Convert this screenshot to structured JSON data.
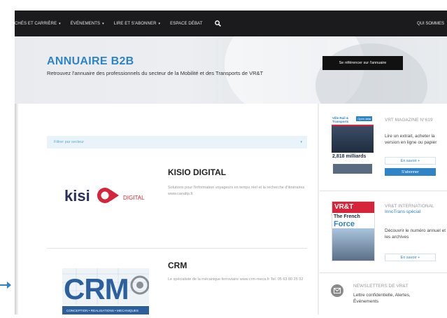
{
  "nav": {
    "items": [
      "CHÉS ET CARRIÈRE",
      "ÉVÉNEMENTS",
      "LIRE ET S'ABONNER",
      "ESPACE DÉBAT"
    ],
    "right": "QUI SOMMES"
  },
  "hero": {
    "title": "ANNUAIRE B2B",
    "subtitle": "Retrouvez l'annuaire des professionnels du secteur de la Mobilité et des Transports de VR&T",
    "button": "Se référencer sur l'annuaire"
  },
  "filter": {
    "placeholder": "Filtrer par secteur"
  },
  "companies": [
    {
      "name": "KISIO DIGITAL",
      "description": "Solutions pour l'information voyageurs en temps réel et la recherche d'itinéraires www.canaltp.fr",
      "logo_text": "kisio",
      "logo_sub": "DIGITAL"
    },
    {
      "name": "CRM",
      "description": "Le spécialiste de la mécanique ferroviaire www.crm-meca.fr Tel. 05 63 80 25 32",
      "logo_text": "CRM",
      "logo_sub": "CONCEPTION • REALISATIONS • MECANIQUES"
    }
  ],
  "sidebar": {
    "magazine": {
      "title": "VRT MAGAZINE N°619",
      "text": "Lire un extrait, acheter la version en ligne ou papier",
      "btn_more": "En savoir +",
      "btn_sub": "S'abonner",
      "cover_brand": "Ville Rail & Transports",
      "cover_tag": "Open data",
      "cover_headline": "2,818 milliards"
    },
    "international": {
      "title_a": "VR&T INTERNATIONAL",
      "title_b": "InnoTrans spécial",
      "text": "Découvrir le numéro annuel et les archives",
      "btn_more": "En savoir +",
      "cover_brand": "VR&T",
      "cover_headline_a": "The French",
      "cover_headline_b": "Force"
    },
    "newsletter": {
      "title": "NEWSLETTERS DE VR&T",
      "text": "Lettre confidentielle, Alertes, Événements"
    }
  },
  "colors": {
    "accent": "#2e84c6",
    "nav_bg": "#1b1b1d",
    "kisio_red": "#d6243b",
    "kisio_navy": "#2a2f5b",
    "crm_blue": "#2b5f9e"
  }
}
